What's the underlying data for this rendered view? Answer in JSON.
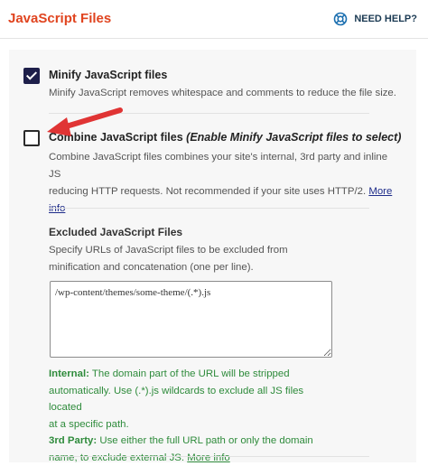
{
  "header": {
    "title": "JavaScript Files",
    "help_label": "NEED HELP?"
  },
  "minify": {
    "checked": true,
    "label": "Minify JavaScript files",
    "description": "Minify JavaScript removes whitespace and comments to reduce the file size."
  },
  "combine": {
    "checked": false,
    "label": "Combine JavaScript files",
    "label_note": "(Enable Minify JavaScript files to select)",
    "description_line1": "Combine JavaScript files combines your site's internal, 3rd party and inline JS",
    "description_line2": "reducing HTTP requests. Not recommended if your site uses HTTP/2.",
    "more_info": "More",
    "more_info_2": "info"
  },
  "excluded": {
    "title": "Excluded JavaScript Files",
    "description_line1": "Specify URLs of JavaScript files to be excluded from",
    "description_line2": "minification and concatenation (one per line).",
    "textarea_value": "/wp-content/themes/some-theme/(.*).js",
    "internal_label": "Internal:",
    "internal_line1": "The domain part of the URL will be stripped",
    "internal_line2": "automatically. Use (.*).js wildcards to exclude all JS files located",
    "internal_line3": "at a specific path.",
    "thirdparty_label": "3rd Party:",
    "thirdparty_line1": "Use either the full URL path or only the domain",
    "thirdparty_line2": "name, to exclude external JS.",
    "more_info": "More info"
  },
  "colors": {
    "title": "#e0441f",
    "note_green": "#2e8b3b",
    "checked_fill": "#1e1f4a",
    "annotation_arrow": "#e03434"
  },
  "icons": {
    "help": "lifebuoy-icon",
    "annotation": "red-arrow-annotation"
  }
}
